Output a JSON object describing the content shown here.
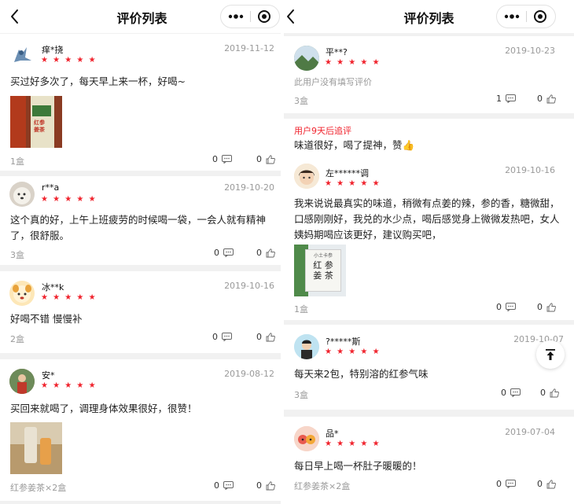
{
  "nav": {
    "title": "评价列表"
  },
  "left_reviews": [
    {
      "user": "痒*挠",
      "date": "2019-11-12",
      "stars": "★ ★ ★ ★ ★",
      "content": "买过好多次了，每天早上来一杯，好喝~",
      "spec": "1盒",
      "comments": "0",
      "likes": "0"
    },
    {
      "user": "r**a",
      "date": "2019-10-20",
      "stars": "★ ★ ★ ★ ★",
      "content_lines": [
        "这个真的好，上午上班疲劳的时候喝一袋，一会人就有精神",
        "了，很舒服。"
      ],
      "spec": "3盒",
      "comments": "0",
      "likes": "0"
    },
    {
      "user": "冰**k",
      "date": "2019-10-16",
      "stars": "★ ★ ★ ★ ★",
      "content": "好喝不错 慢慢补",
      "spec": "2盒",
      "comments": "0",
      "likes": "0"
    },
    {
      "user": "安*",
      "date": "2019-08-12",
      "stars": "★ ★ ★ ★ ★",
      "content": "买回来就喝了，调理身体效果很好，很赞！",
      "spec": "红参姜茶×2盒",
      "comments": "0",
      "likes": "0"
    }
  ],
  "right_reviews": [
    {
      "user": "平**?",
      "date": "2019-10-23",
      "stars": "★ ★ ★ ★ ★",
      "content": "此用户没有填写评价",
      "spec": "3盒",
      "comments": "1",
      "likes": "0",
      "followup_label": "用户9天后追评",
      "followup_text": "味道很好，喝了提神，赞👍"
    },
    {
      "user": "左******调",
      "date": "2019-10-16",
      "stars": "★ ★ ★ ★ ★",
      "content_lines": [
        "我来说说最真实的味道，稍微有点姜的辣，参的香，糖微甜，",
        "口感刚刚好，我兑的水少点，喝后感觉身上微微发热吧，女人",
        "姨妈期喝应该更好，建议购买吧，"
      ],
      "spec": "1盒",
      "comments": "0",
      "likes": "0",
      "package_text": {
        "top": "小土卡参",
        "line1": "红 参",
        "line2": "姜 茶"
      }
    },
    {
      "user": "?*****斯",
      "date": "2019-10-07",
      "stars": "★ ★ ★ ★ ★",
      "content": "每天来2包，特别溶的红参气味",
      "spec": "3盒",
      "comments": "0",
      "likes": "0"
    },
    {
      "user": "品*",
      "date": "2019-07-04",
      "stars": "★ ★ ★ ★ ★",
      "content": "每日早上喝一杯肚子暖暖的！",
      "spec": "红参姜茶×2盒",
      "comments": "0",
      "likes": "0"
    }
  ],
  "product_label": {
    "line1": "红参",
    "line2": "姜茶"
  },
  "colors": {
    "star": "#f0232d",
    "muted": "#9a9a9a",
    "background": "#f1f1f1"
  },
  "icons": {
    "back": "chevron-left-icon",
    "more": "more-dots-icon",
    "close": "target-circle-icon",
    "comment": "comment-bubble-icon",
    "like": "thumbs-up-icon",
    "top": "back-to-top-icon"
  }
}
